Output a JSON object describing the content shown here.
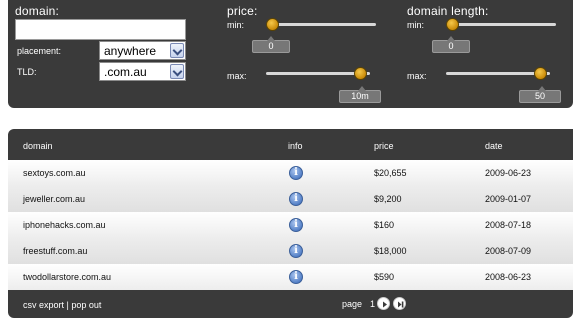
{
  "filters": {
    "domain_label": "domain:",
    "domain_value": "",
    "placement_label": "placement:",
    "placement_value": "anywhere",
    "tld_label": "TLD:",
    "tld_value": ".com.au",
    "price": {
      "label": "price:",
      "min_label": "min:",
      "min_value": "0",
      "max_label": "max:",
      "max_value": "10m"
    },
    "length": {
      "label": "domain length:",
      "min_label": "min:",
      "min_value": "0",
      "max_label": "max:",
      "max_value": "50"
    }
  },
  "table": {
    "columns": [
      "domain",
      "info",
      "price",
      "date"
    ],
    "rows": [
      {
        "domain": "sextoys.com.au",
        "price": "$20,655",
        "date": "2009-06-23"
      },
      {
        "domain": "jeweller.com.au",
        "price": "$9,200",
        "date": "2009-01-07"
      },
      {
        "domain": "iphonehacks.com.au",
        "price": "$160",
        "date": "2008-07-18"
      },
      {
        "domain": "freestuff.com.au",
        "price": "$18,000",
        "date": "2008-07-09"
      },
      {
        "domain": "twodollarstore.com.au",
        "price": "$590",
        "date": "2008-06-23"
      }
    ],
    "info_icon_glyph": "i"
  },
  "footer": {
    "csv_export": "csv export",
    "separator": "|",
    "pop_out": "pop out",
    "page_label": "page",
    "page_number": "1"
  },
  "colors": {
    "panel": "#3a3a3a",
    "knob": "#d89a12",
    "info_icon": "#5b86c9"
  }
}
